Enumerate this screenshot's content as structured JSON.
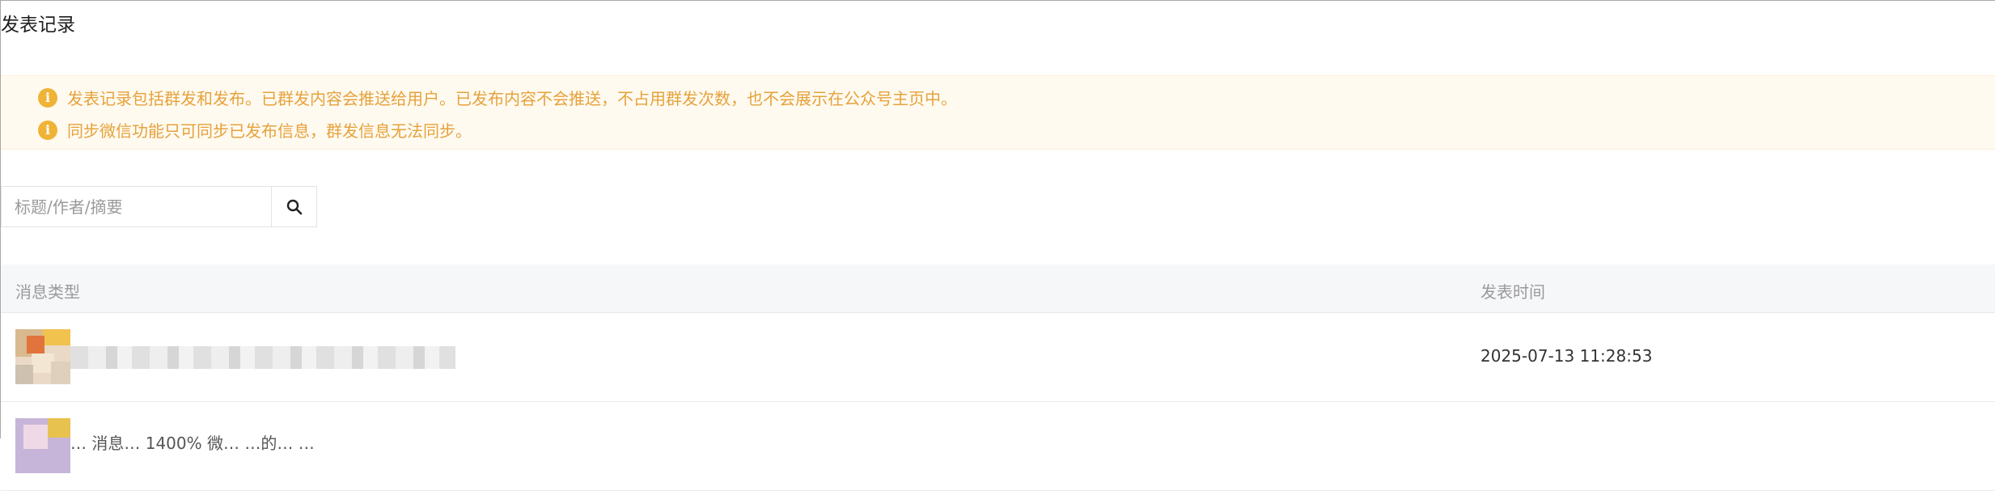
{
  "page": {
    "title": "发表记录"
  },
  "notice": {
    "lines": [
      "发表记录包括群发和发布。已群发内容会推送给用户。已发布内容不会推送，不占用群发次数，也不会展示在公众号主页中。",
      "同步微信功能只可同步已发布信息，群发信息无法同步。"
    ],
    "icon": "info-icon",
    "color": "#e5a23b"
  },
  "search": {
    "placeholder": "标题/作者/摘要",
    "value": "",
    "icon": "search-icon"
  },
  "table": {
    "columns": [
      "消息类型",
      "发表时间"
    ],
    "rows": [
      {
        "title": "",
        "time": "2025-07-13 11:28:53",
        "thumbnail": "article-thumbnail"
      },
      {
        "title": "… 消息… 1400% 微… …的… …",
        "time": "",
        "thumbnail": "article-thumbnail"
      }
    ]
  }
}
